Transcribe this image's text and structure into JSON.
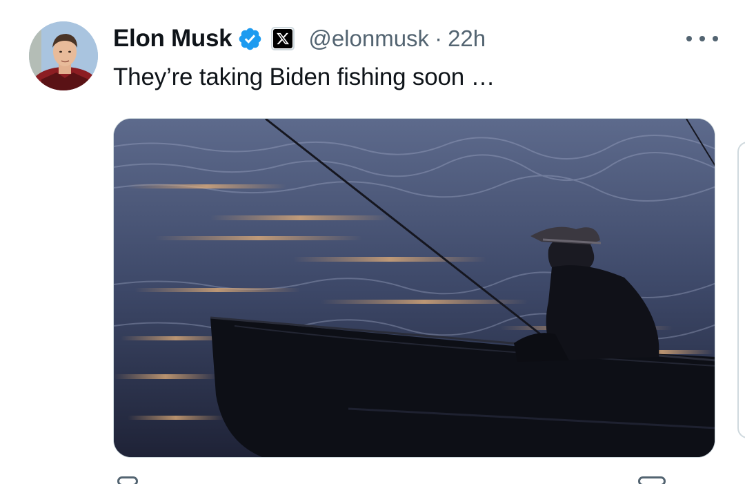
{
  "tweet": {
    "author_name": "Elon Musk",
    "handle": "@elonmusk",
    "separator": "·",
    "time": "22h",
    "text": "They’re taking Biden fishing soon …"
  },
  "icons": {
    "verified": "verified-badge-icon",
    "affiliation": "x-logo-icon",
    "more": "more-options-icon"
  },
  "colors": {
    "verified_blue": "#1d9bf0",
    "secondary_text": "#536471",
    "primary_text": "#0f1419",
    "border": "#cfd9de"
  }
}
